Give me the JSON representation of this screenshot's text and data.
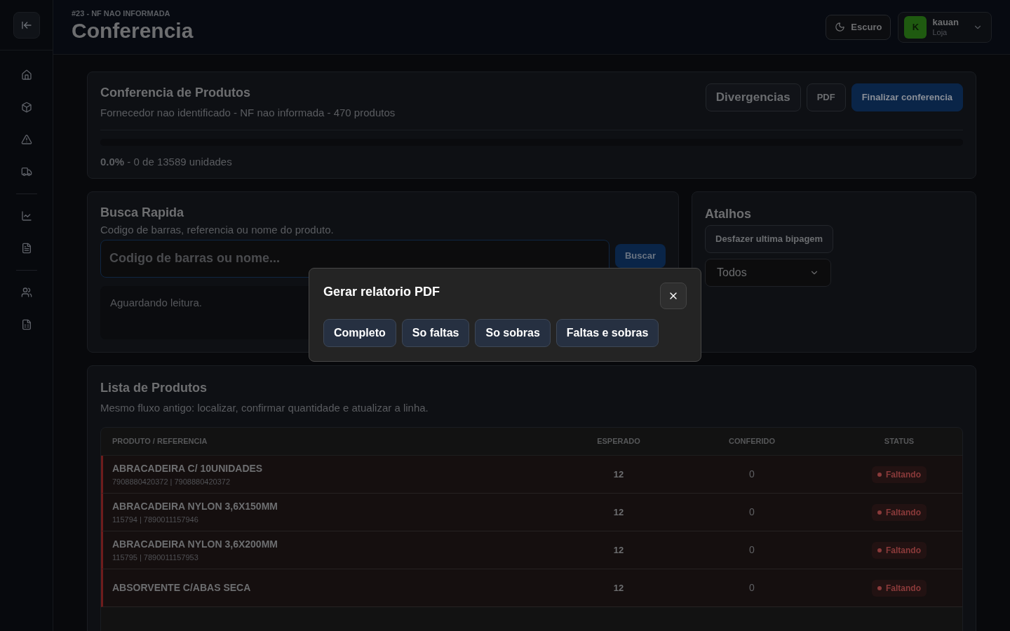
{
  "header": {
    "eyebrow": "#23 - NF NAO INFORMADA",
    "title": "Conferencia",
    "theme_button": "Escuro",
    "user": {
      "initial": "K",
      "name": "kauan",
      "role": "Loja"
    }
  },
  "summary": {
    "title": "Conferencia de Produtos",
    "subtitle": "Fornecedor nao identificado - NF nao informada - 470 produtos",
    "buttons": [
      {
        "label": "Divergencias",
        "kind": "large"
      },
      {
        "label": "PDF",
        "kind": "small"
      },
      {
        "label": "Finalizar conferencia",
        "kind": "primary"
      }
    ],
    "progress": {
      "level": 0,
      "label": "**0.0%** - 0 de 13589 unidades"
    }
  },
  "search": {
    "title": "Busca Rapida",
    "subtitle": "Codigo de barras, referencia ou nome do produto.",
    "placeholder": "Codigo de barras ou nome...",
    "button": "Buscar",
    "status": "Aguardando leitura."
  },
  "shortcuts": {
    "title": "Atalhos",
    "undo_button": "Desfazer ultima bipagem",
    "filter": "Todos"
  },
  "products": {
    "title": "Lista de Produtos",
    "subtitle": "Mesmo fluxo antigo: localizar, confirmar quantidade e atualizar a linha.",
    "columns": [
      "PRODUTO / REFERENCIA",
      "ESPERADO",
      "CONFERIDO",
      "STATUS"
    ],
    "rows": [
      {
        "name": "ABRACADEIRA C/ 10UNIDADES",
        "reference": "7908880420372 | 7908880420372",
        "expected": "12",
        "checked": "0",
        "status": "Faltando",
        "color": "#8a3a3a"
      },
      {
        "name": "ABRACADEIRA NYLON 3,6X150MM",
        "reference": "115794 | 7890011157946",
        "expected": "12",
        "checked": "0",
        "status": "Faltando",
        "color": "#8a3a3a"
      },
      {
        "name": "ABRACADEIRA NYLON 3,6X200MM",
        "reference": "115795 | 7890011157953",
        "expected": "12",
        "checked": "0",
        "status": "Faltando",
        "color": "#8a3a3a"
      },
      {
        "name": "ABSORVENTE C/ABAS SECA",
        "expected": "12",
        "checked": "0",
        "status": "Faltando",
        "color": "#8a3a3a"
      }
    ]
  },
  "dialog": {
    "title": "Gerar relatorio PDF",
    "options": [
      "Completo",
      "So faltas",
      "So sobras",
      "Faltas e sobras"
    ]
  }
}
